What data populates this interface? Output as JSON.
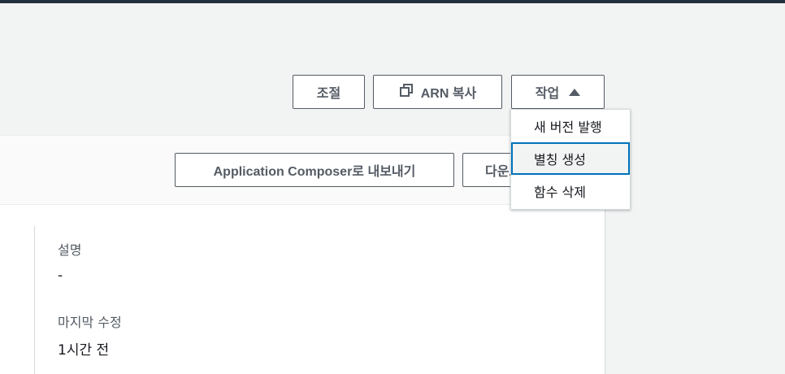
{
  "toolbar": {
    "adjust_label": "조절",
    "copy_arn_label": "ARN 복사",
    "actions_label": "작업"
  },
  "actions_menu": {
    "items": [
      {
        "label": "새 버전 발행"
      },
      {
        "label": "별칭 생성",
        "active": true
      },
      {
        "label": "함수 삭제"
      }
    ]
  },
  "function_header": {
    "export_label": "Application Composer로 내보내기",
    "download_label": "다운로드"
  },
  "details": {
    "description_label": "설명",
    "description_value": "-",
    "last_modified_label": "마지막 수정",
    "last_modified_value": "1시간 전"
  },
  "colors": {
    "accent": "#0073bb",
    "topbar": "#232f3e"
  },
  "icons": {
    "copy": "copy-icon",
    "caret": "caret-up-icon"
  }
}
